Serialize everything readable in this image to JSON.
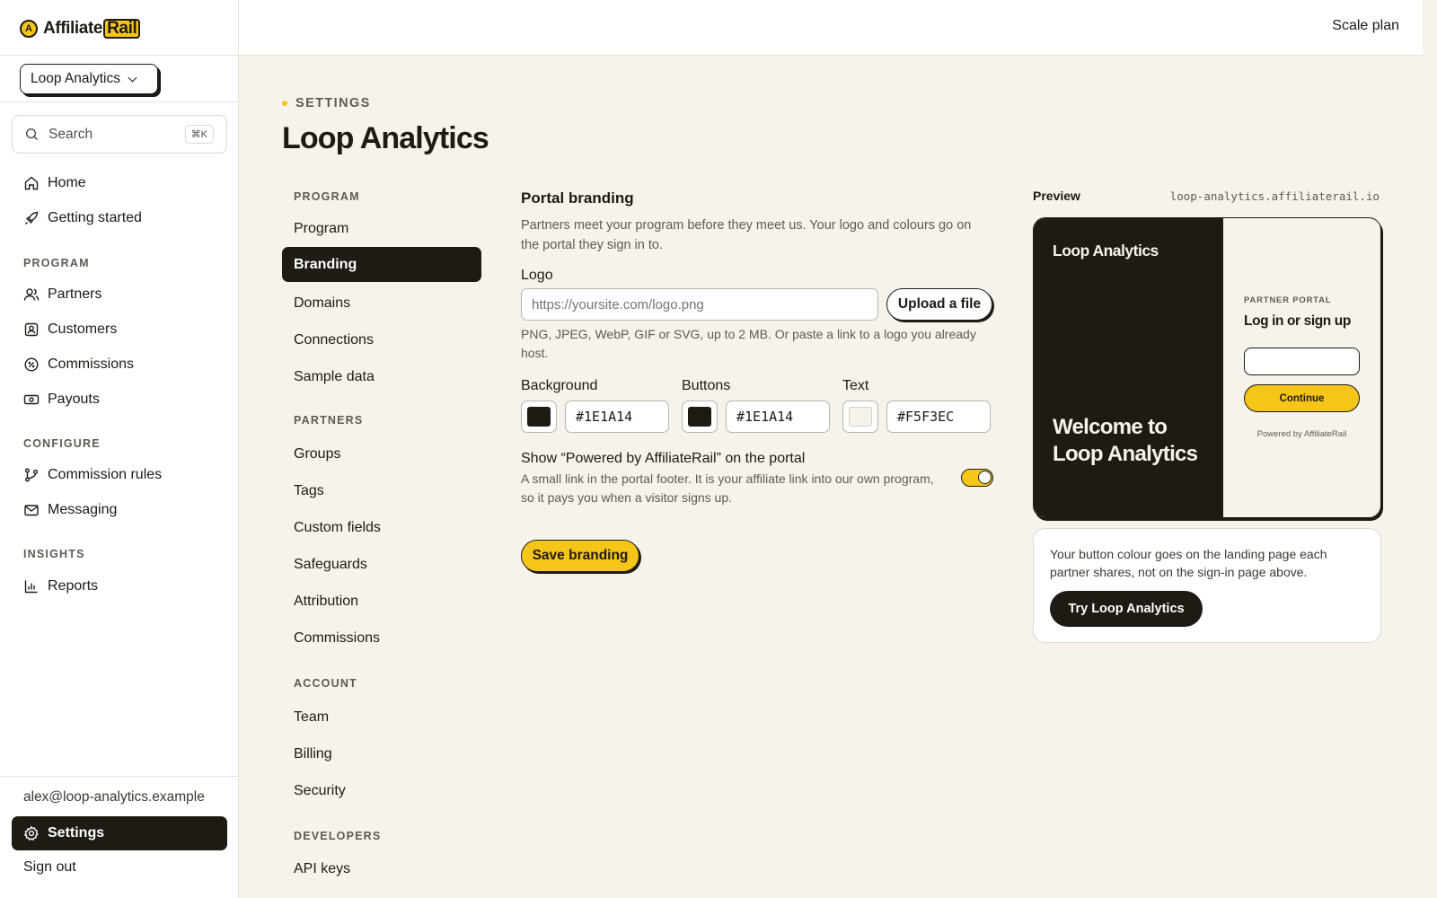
{
  "brand": {
    "name_plain": "Affiliate",
    "name_highlight": "Rail",
    "mark": "A"
  },
  "workspace": {
    "name": "Loop Analytics"
  },
  "search": {
    "label": "Search",
    "shortcut": "⌘K"
  },
  "nav": {
    "home": "Home",
    "getting_started": "Getting started",
    "program_section": "PROGRAM",
    "partners": "Partners",
    "customers": "Customers",
    "commissions": "Commissions",
    "payouts": "Payouts",
    "configure_section": "CONFIGURE",
    "commission_rules": "Commission rules",
    "messaging": "Messaging",
    "insights_section": "INSIGHTS",
    "reports": "Reports"
  },
  "account": {
    "email": "alex@loop-analytics.example",
    "settings": "Settings",
    "sign_out": "Sign out"
  },
  "topbar": {
    "plan": "Scale plan"
  },
  "page": {
    "eyebrow": "SETTINGS",
    "title": "Loop Analytics"
  },
  "subnav": {
    "program_section": "PROGRAM",
    "program": "Program",
    "branding": "Branding",
    "domains": "Domains",
    "connections": "Connections",
    "sample_data": "Sample data",
    "partners_section": "PARTNERS",
    "groups": "Groups",
    "tags": "Tags",
    "custom_fields": "Custom fields",
    "safeguards": "Safeguards",
    "attribution": "Attribution",
    "commissions": "Commissions",
    "account_section": "ACCOUNT",
    "team": "Team",
    "billing": "Billing",
    "security": "Security",
    "developers_section": "DEVELOPERS",
    "api_keys": "API keys"
  },
  "form": {
    "title": "Portal branding",
    "description": "Partners meet your program before they meet us. Your logo and colours go on the portal they sign in to.",
    "logo_label": "Logo",
    "logo_placeholder": "https://yoursite.com/logo.png",
    "upload_label": "Upload a file",
    "logo_help": "PNG, JPEG, WebP, GIF or SVG, up to 2 MB. Or paste a link to a logo you already host.",
    "background_label": "Background",
    "background_value": "#1E1A14",
    "buttons_label": "Buttons",
    "buttons_value": "#1E1A14",
    "text_label": "Text",
    "text_value": "#F5F3EC",
    "powered_title": "Show “Powered by AffiliateRail” on the portal",
    "powered_desc": "A small link in the portal footer. It is your affiliate link into our own program, so it pays you when a visitor signs up.",
    "powered_enabled": true,
    "save_label": "Save branding"
  },
  "preview": {
    "label": "Preview",
    "url": "loop-analytics.affiliaterail.io",
    "brand": "Loop Analytics",
    "welcome": "Welcome to Loop Analytics",
    "kicker": "PARTNER PORTAL",
    "heading": "Log in or sign up",
    "continue": "Continue",
    "powered": "Powered by AffiliateRail",
    "note": "Your button colour goes on the landing page each partner shares, not on the sign-in page above.",
    "try_label": "Try Loop Analytics"
  },
  "colors": {
    "ink": "#1E1A14",
    "accent": "#F5C518",
    "canvas": "#F5F3EC"
  }
}
